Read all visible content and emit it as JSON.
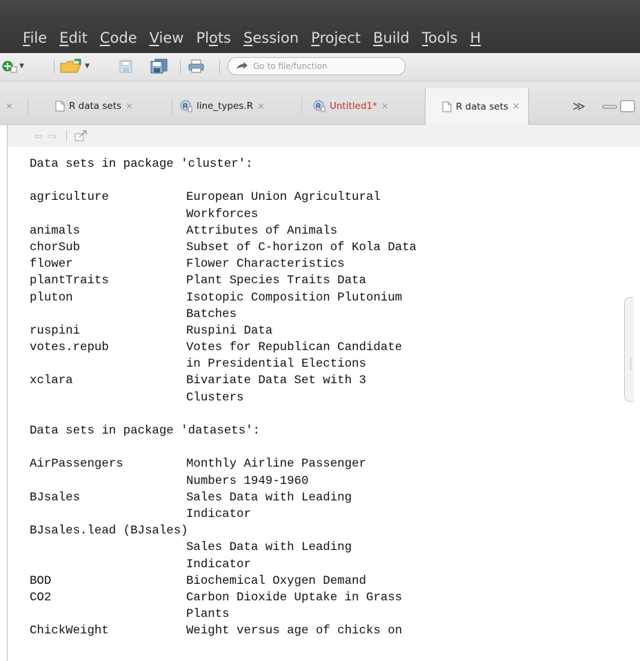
{
  "menubar": {
    "items": [
      {
        "label": "File",
        "u": "F",
        "rest": "ile"
      },
      {
        "label": "Edit",
        "u": "E",
        "rest": "dit"
      },
      {
        "label": "Code",
        "u": "C",
        "rest": "ode"
      },
      {
        "label": "View",
        "u": "V",
        "rest": "iew"
      },
      {
        "label": "Plots",
        "pre": "Pl",
        "u": "o",
        "rest": "ts"
      },
      {
        "label": "Session",
        "u": "S",
        "rest": "ession"
      },
      {
        "label": "Project",
        "u": "P",
        "rest": "roject"
      },
      {
        "label": "Build",
        "u": "B",
        "rest": "uild"
      },
      {
        "label": "Tools",
        "u": "T",
        "rest": "ools"
      },
      {
        "label": "H",
        "u": "H",
        "rest": ""
      }
    ]
  },
  "toolbar": {
    "goto_placeholder": "Go to file/function"
  },
  "tabs": {
    "leading_close": "×",
    "close_glyph": "×",
    "items": [
      {
        "label": "R data sets",
        "icon": "doc-icon",
        "unsaved": false,
        "active": false
      },
      {
        "label": "line_types.R",
        "icon": "r-script-icon",
        "unsaved": false,
        "active": false
      },
      {
        "label": "Untitled1*",
        "icon": "r-script-icon",
        "unsaved": true,
        "active": false
      },
      {
        "label": "R data sets",
        "icon": "doc-icon",
        "unsaved": false,
        "active": true
      }
    ],
    "overflow": "≫"
  },
  "content": {
    "lines": [
      {
        "name": "Data sets in package 'cluster':",
        "desc": "",
        "full": true
      },
      {
        "name": "",
        "desc": ""
      },
      {
        "name": "agriculture",
        "desc": "European Union Agricultural"
      },
      {
        "name": "",
        "desc": "Workforces"
      },
      {
        "name": "animals",
        "desc": "Attributes of Animals"
      },
      {
        "name": "chorSub",
        "desc": "Subset of C-horizon of Kola Data"
      },
      {
        "name": "flower",
        "desc": "Flower Characteristics"
      },
      {
        "name": "plantTraits",
        "desc": "Plant Species Traits Data"
      },
      {
        "name": "pluton",
        "desc": "Isotopic Composition Plutonium"
      },
      {
        "name": "",
        "desc": "Batches"
      },
      {
        "name": "ruspini",
        "desc": "Ruspini Data"
      },
      {
        "name": "votes.repub",
        "desc": "Votes for Republican Candidate"
      },
      {
        "name": "",
        "desc": "in Presidential Elections"
      },
      {
        "name": "xclara",
        "desc": "Bivariate Data Set with 3"
      },
      {
        "name": "",
        "desc": "Clusters"
      },
      {
        "name": "",
        "desc": ""
      },
      {
        "name": "Data sets in package 'datasets':",
        "desc": "",
        "full": true
      },
      {
        "name": "",
        "desc": ""
      },
      {
        "name": "AirPassengers",
        "desc": "Monthly Airline Passenger"
      },
      {
        "name": "",
        "desc": "Numbers 1949-1960"
      },
      {
        "name": "BJsales",
        "desc": "Sales Data with Leading"
      },
      {
        "name": "",
        "desc": "Indicator"
      },
      {
        "name": "BJsales.lead (BJsales)",
        "desc": "",
        "full": true
      },
      {
        "name": "",
        "desc": "Sales Data with Leading"
      },
      {
        "name": "",
        "desc": "Indicator"
      },
      {
        "name": "BOD",
        "desc": "Biochemical Oxygen Demand"
      },
      {
        "name": "CO2",
        "desc": "Carbon Dioxide Uptake in Grass"
      },
      {
        "name": "",
        "desc": "Plants"
      },
      {
        "name": "ChickWeight",
        "desc": "Weight versus age of chicks on"
      }
    ]
  }
}
